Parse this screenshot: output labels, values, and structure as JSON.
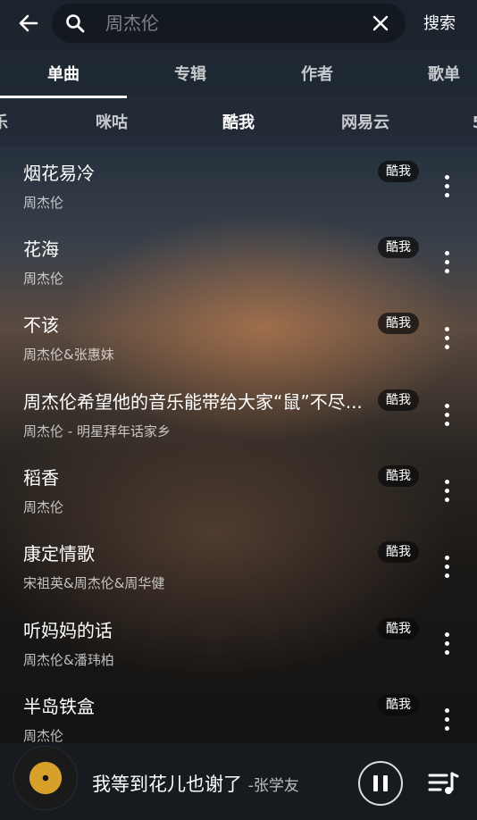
{
  "search": {
    "placeholder": "周杰伦",
    "submit_label": "搜索"
  },
  "tabs": [
    {
      "label": "单曲",
      "active": true
    },
    {
      "label": "专辑",
      "active": false
    },
    {
      "label": "作者",
      "active": false
    },
    {
      "label": "歌单",
      "active": false
    }
  ],
  "sources": [
    {
      "label": "乐",
      "active": false
    },
    {
      "label": "咪咕",
      "active": false
    },
    {
      "label": "酷我",
      "active": true
    },
    {
      "label": "网易云",
      "active": false
    },
    {
      "label": "5",
      "active": false
    }
  ],
  "songs": [
    {
      "title": "烟花易冷",
      "artist": "周杰伦",
      "source": "酷我"
    },
    {
      "title": "花海",
      "artist": "周杰伦",
      "source": "酷我"
    },
    {
      "title": "不该",
      "artist": "周杰伦&张惠妹",
      "source": "酷我"
    },
    {
      "title": "周杰伦希望他的音乐能带给大家“鼠”不尽...",
      "artist": "周杰伦 - 明星拜年话家乡",
      "source": "酷我"
    },
    {
      "title": "稻香",
      "artist": "周杰伦",
      "source": "酷我"
    },
    {
      "title": "康定情歌",
      "artist": "宋祖英&周杰伦&周华健",
      "source": "酷我"
    },
    {
      "title": "听妈妈的话",
      "artist": "周杰伦&潘玮柏",
      "source": "酷我"
    },
    {
      "title": "半岛铁盒",
      "artist": "周杰伦",
      "source": "酷我"
    }
  ],
  "player": {
    "title": "我等到花儿也谢了",
    "artist": "-张学友"
  },
  "icons": {
    "back": "arrow-left-icon",
    "search": "search-icon",
    "clear": "close-icon",
    "more": "more-vertical-icon",
    "pause": "pause-icon",
    "playlist": "playlist-icon"
  }
}
